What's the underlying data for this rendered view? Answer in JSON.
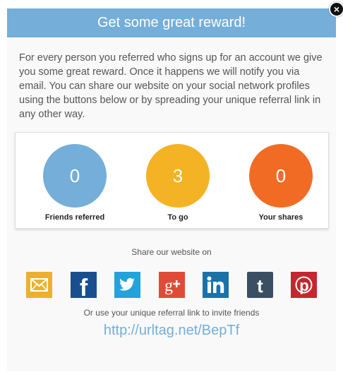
{
  "modal": {
    "title": "Get some great reward!",
    "close_glyph": "×",
    "description": "For every person you referred who signs up for an account we give you some great reward. Once it happens we will notify you via email. You can share our website on your social network profiles using the buttons below or by spreading your unique referral link in any other way."
  },
  "stats": [
    {
      "value": "0",
      "label": "Friends referred",
      "color": "#74aed9"
    },
    {
      "value": "3",
      "label": "To go",
      "color": "#f4b225"
    },
    {
      "value": "0",
      "label": "Your shares",
      "color": "#f26b25"
    }
  ],
  "share": {
    "title": "Share our website on",
    "icons": [
      {
        "name": "email-icon",
        "color": "#eab22c"
      },
      {
        "name": "facebook-icon",
        "color": "#194f8e"
      },
      {
        "name": "twitter-icon",
        "color": "#22a3d9"
      },
      {
        "name": "google-plus-icon",
        "color": "#e04b38"
      },
      {
        "name": "linkedin-icon",
        "color": "#1a72a8"
      },
      {
        "name": "tumblr-icon",
        "color": "#3b4f63"
      },
      {
        "name": "pinterest-icon",
        "color": "#c3282f"
      }
    ]
  },
  "referral": {
    "text": "Or use your unique referral link to invite friends",
    "link": "http://urltag.net/BepTf"
  }
}
